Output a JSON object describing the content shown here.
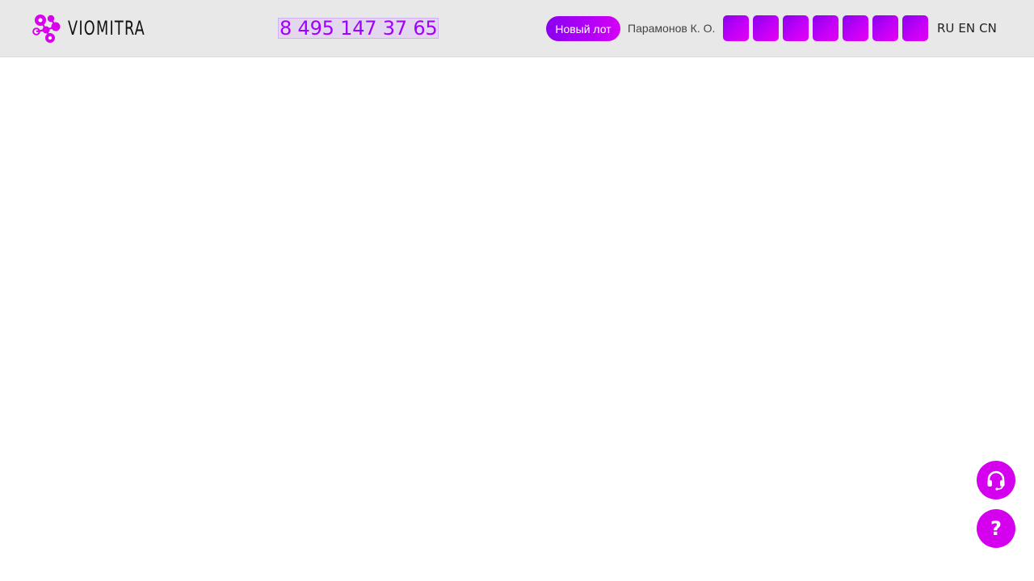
{
  "header": {
    "logo": {
      "text": "VIOMITRA",
      "icon": "molecule-logo-icon"
    },
    "phone": "8 495 147 37 65",
    "new_lot_label": "Новый лот",
    "user_name": "Парамонов К. О.",
    "icon_buttons": [
      {
        "icon": "purple-square-icon"
      },
      {
        "icon": "purple-square-icon"
      },
      {
        "icon": "purple-square-icon"
      },
      {
        "icon": "purple-square-icon"
      },
      {
        "icon": "purple-square-icon"
      },
      {
        "icon": "purple-square-icon"
      },
      {
        "icon": "purple-square-icon"
      }
    ],
    "languages": [
      "RU",
      "EN",
      "CN"
    ]
  },
  "floating": {
    "support_icon": "headset-icon",
    "help_label": "?"
  },
  "colors": {
    "header_bg": "#e8e8e8",
    "accent": "#a000ff",
    "fab": "#d400ee"
  }
}
